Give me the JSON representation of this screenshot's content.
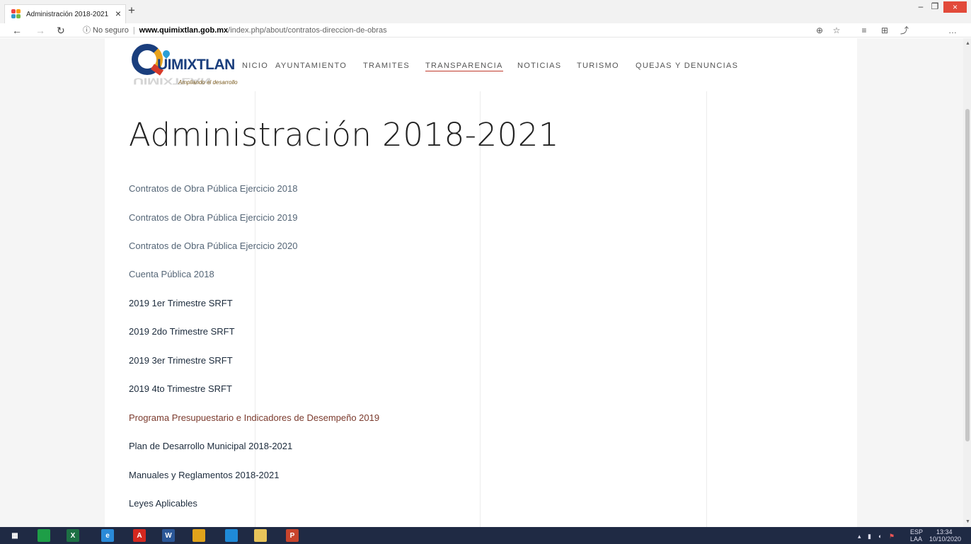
{
  "browser": {
    "tab_title": "Administración 2018-2021",
    "tab_close": "×",
    "new_tab": "+",
    "security_label": "ⓘ No seguro",
    "url_host": "www.quimixtlan.gob.mx",
    "url_path": "/index.php/about/contratos-direccion-de-obras",
    "window_minimize": "–",
    "window_restore": "❐",
    "window_close": "×"
  },
  "site": {
    "logo_text": "UIMIXTLAN",
    "logo_tagline": "Ampliando el desarrollo",
    "nav": [
      {
        "label": "NICIO"
      },
      {
        "label": "AYUNTAMIENTO"
      },
      {
        "label": "TRAMITES"
      },
      {
        "label": "TRANSPARENCIA"
      },
      {
        "label": "NOTICIAS"
      },
      {
        "label": "TURISMO"
      },
      {
        "label": "QUEJAS Y DENUNCIAS"
      }
    ],
    "page_title": "Administración 2018-2021",
    "links": [
      {
        "label": "Contratos de Obra Pública Ejercicio 2018"
      },
      {
        "label": "Contratos de Obra Pública Ejercicio 2019"
      },
      {
        "label": "Contratos de Obra Pública Ejercicio 2020"
      },
      {
        "label": "Cuenta Pública 2018"
      },
      {
        "label": "2019 1er Trimestre SRFT"
      },
      {
        "label": "2019 2do Trimestre SRFT"
      },
      {
        "label": "2019 3er Trimestre SRFT"
      },
      {
        "label": "2019 4to Trimestre SRFT"
      },
      {
        "label": "Programa Presupuestario e Indicadores de Desempeño 2019"
      },
      {
        "label": "Plan de Desarrollo Municipal 2018-2021"
      },
      {
        "label": "Manuales y Reglamentos 2018-2021"
      },
      {
        "label": "Leyes Aplicables"
      }
    ]
  },
  "taskbar": {
    "apps": [
      {
        "name": "windows-start",
        "glyph": "",
        "color": "#ffffff"
      },
      {
        "name": "store",
        "glyph": "",
        "color": "#1e9e47"
      },
      {
        "name": "excel",
        "glyph": "X",
        "color": "#1d7044"
      },
      {
        "name": "internet-explorer",
        "glyph": "e",
        "color": "#2a8ad8"
      },
      {
        "name": "acrobat",
        "glyph": "A",
        "color": "#d4281f"
      },
      {
        "name": "word",
        "glyph": "W",
        "color": "#2b5797"
      },
      {
        "name": "chrome",
        "glyph": "",
        "color": "#e0a31b"
      },
      {
        "name": "edge",
        "glyph": "",
        "color": "#1f8ad8"
      },
      {
        "name": "file-explorer",
        "glyph": "",
        "color": "#e8c45a"
      },
      {
        "name": "powerpoint",
        "glyph": "P",
        "color": "#c8442c"
      }
    ],
    "lang_top": "ESP",
    "lang_bottom": "LAA",
    "time": "13:34",
    "date": "10/10/2020"
  },
  "colors": {
    "accent_underline": "#c0392b",
    "taskbar_bg": "#1f2a44",
    "link_thin": "#556677",
    "link_dark": "#1c2b3c",
    "link_red": "#7b3b2e"
  }
}
